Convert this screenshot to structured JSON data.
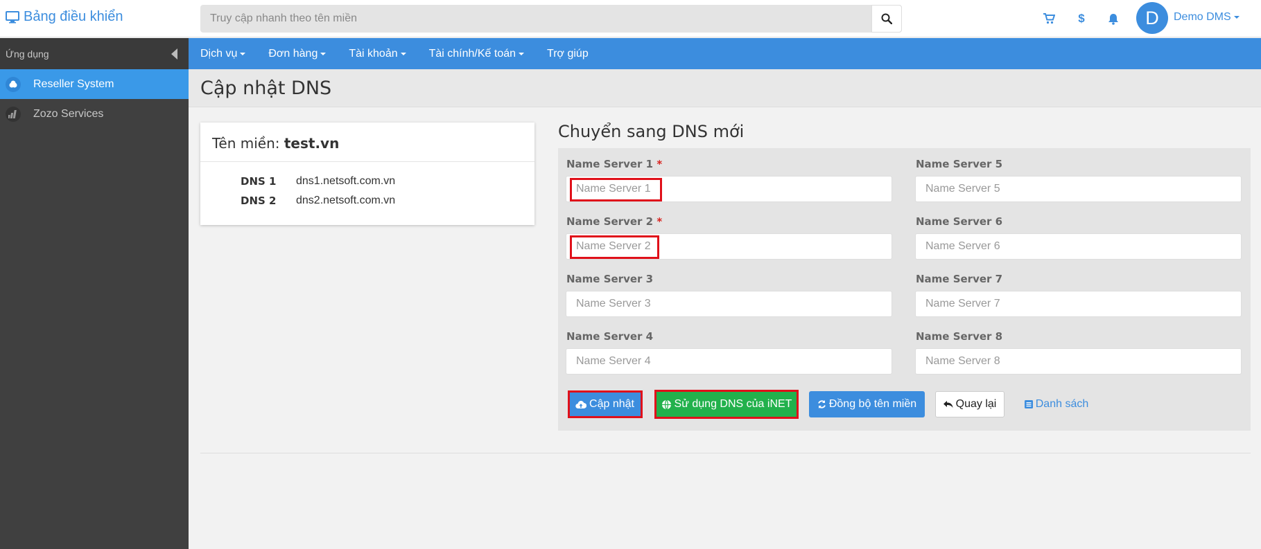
{
  "header": {
    "brand": "Bảng điều khiển",
    "search_placeholder": "Truy cập nhanh theo tên miền",
    "user_initial": "D",
    "user_name": "Demo DMS",
    "dollar_symbol": "$"
  },
  "sidebar": {
    "title": "Ứng dụng",
    "items": [
      {
        "label": "Reseller System",
        "active": true
      },
      {
        "label": "Zozo Services",
        "active": false
      }
    ]
  },
  "nav": {
    "items": [
      "Dịch vụ",
      "Đơn hàng",
      "Tài khoản",
      "Tài chính/Kế toán",
      "Trợ giúp"
    ]
  },
  "page": {
    "title": "Cập nhật DNS"
  },
  "domain_card": {
    "label": "Tên miền:",
    "domain": "test.vn",
    "dns": [
      {
        "label": "DNS 1",
        "value": "dns1.netsoft.com.vn"
      },
      {
        "label": "DNS 2",
        "value": "dns2.netsoft.com.vn"
      }
    ]
  },
  "form": {
    "title": "Chuyển sang DNS mới",
    "required_mark": "*",
    "fields": [
      {
        "label": "Name Server 1",
        "placeholder": "Name Server 1",
        "required": true
      },
      {
        "label": "Name Server 2",
        "placeholder": "Name Server 2",
        "required": true
      },
      {
        "label": "Name Server 3",
        "placeholder": "Name Server 3",
        "required": false
      },
      {
        "label": "Name Server 4",
        "placeholder": "Name Server 4",
        "required": false
      },
      {
        "label": "Name Server 5",
        "placeholder": "Name Server 5",
        "required": false
      },
      {
        "label": "Name Server 6",
        "placeholder": "Name Server 6",
        "required": false
      },
      {
        "label": "Name Server 7",
        "placeholder": "Name Server 7",
        "required": false
      },
      {
        "label": "Name Server 8",
        "placeholder": "Name Server 8",
        "required": false
      }
    ],
    "buttons": {
      "update": "Cập nhật",
      "use_inet": "Sử dụng DNS của iNET",
      "sync": "Đồng bộ tên miền",
      "back": "Quay lại",
      "list": "Danh sách"
    }
  },
  "colors": {
    "primary": "#3c8dde",
    "success": "#22b14c",
    "highlight": "#e0101a",
    "sidebar": "#404040"
  }
}
